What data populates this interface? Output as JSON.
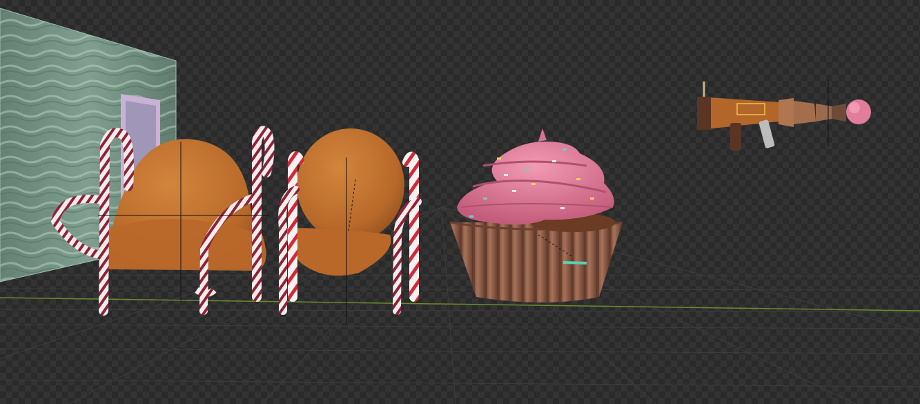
{
  "app": "3D viewport",
  "scene": {
    "objects": [
      "glass-wall",
      "door",
      "gingerbread-chair-left",
      "gingerbread-chair-right",
      "cupcake",
      "candy-bazooka"
    ]
  },
  "colors": {
    "background_dark": "#2a2a2a",
    "background_light": "#333333",
    "grid_line": "#3e3e3e",
    "x_axis": "#6a8c2c",
    "gingerbread": "#c4742f",
    "frosting": "#e07d9a",
    "cupcake_wrapper": "#8a5a42",
    "candy_red": "#c2243a",
    "glass": "#7fa494"
  }
}
